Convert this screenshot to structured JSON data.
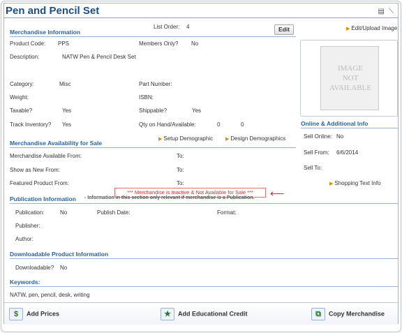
{
  "header": {
    "title": "Pen and Pencil Set",
    "icons": [
      "window-icon",
      "close-slash-icon"
    ]
  },
  "merch_info": {
    "section_title": "Merchandise Information",
    "list_order_label": "List Order:",
    "list_order_value": "4",
    "edit_label": "Edit",
    "upload_link": "Edit/Upload Image",
    "product_code_label": "Product Code:",
    "product_code_value": "PPS",
    "members_only_label": "Members Only?",
    "members_only_value": "No",
    "description_label": "Description:",
    "description_value": "NATW Pen & Pencil Desk Set",
    "category_label": "Category:",
    "category_value": "Misc",
    "part_number_label": "Part Number:",
    "weight_label": "Weight:",
    "isbn_label": "ISBN:",
    "taxable_label": "Taxable?",
    "taxable_value": "Yes",
    "shippable_label": "Shippable?",
    "shippable_value": "Yes",
    "track_inventory_label": "Track Inventory?",
    "track_inventory_value": "Yes",
    "qty_label": "Qty on Hand/Available:",
    "qty_on_hand": "0",
    "qty_available": "0"
  },
  "image": {
    "line1": "IMAGE",
    "line2": "NOT",
    "line3": "AVAILABLE"
  },
  "availability": {
    "section_title": "Merchandise Availability for Sale",
    "setup_link": "Setup Demographic",
    "design_link": "Design Demographics",
    "available_from_label": "Merchandise Available From:",
    "new_from_label": "Show as New From:",
    "featured_from_label": "Featured Product From:",
    "to_label": "To:",
    "warning": "*** Merchandise is Inactive & Not Available for Sale ***"
  },
  "online": {
    "section_title": "Online & Additional Info",
    "sell_online_label": "Sell Online:",
    "sell_online_value": "No",
    "sell_from_label": "Sell From:",
    "sell_from_value": "6/6/2014",
    "sell_to_label": "Sell To:",
    "shopping_link": "Shopping Text Info"
  },
  "publication": {
    "section_title": "Publication Information",
    "note": "- Information in this section only relevant if merchandise is a Publication.",
    "publication_label": "Publication:",
    "publication_value": "No",
    "publish_date_label": "Publish Date:",
    "format_label": "Format:",
    "publisher_label": "Publisher:",
    "author_label": "Author:"
  },
  "downloadable": {
    "section_title": "Downloadable Product Information",
    "downloadable_label": "Downloadable?",
    "downloadable_value": "No"
  },
  "keywords": {
    "section_title": "Keywords:",
    "value": "NATW, pen, pencil, desk, writing"
  },
  "actions": {
    "add_prices": "Add Prices",
    "add_credit": "Add Educational Credit",
    "copy": "Copy Merchandise"
  }
}
